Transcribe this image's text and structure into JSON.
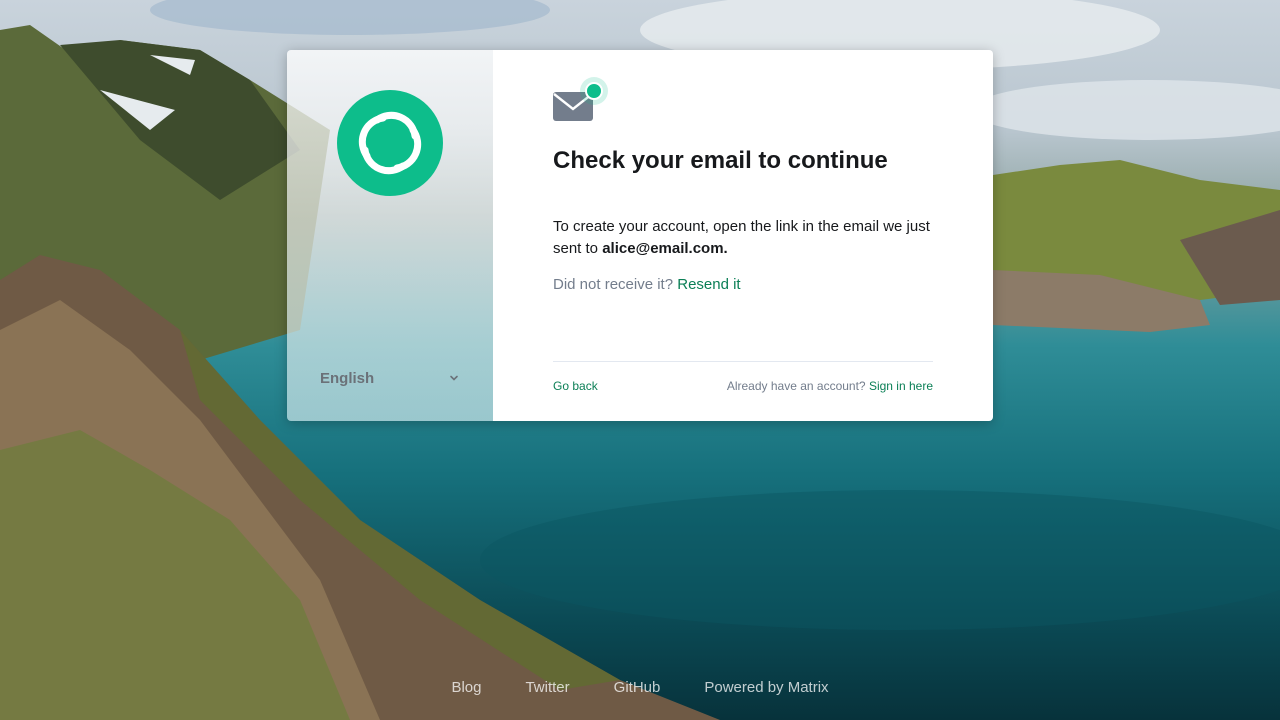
{
  "colors": {
    "brand": "#0dbd8b",
    "link": "#0b7f56",
    "text": "#17191c",
    "muted": "#737d8c"
  },
  "brand_logo": {
    "icon": "element-logo-icon"
  },
  "language": {
    "selected": "English",
    "icon": "chevron-down-icon"
  },
  "card": {
    "icon": "email-notification-icon",
    "title": "Check your email to continue",
    "body_prefix": "To create your account, open the link in the email we just sent to ",
    "email": "alice@email.com.",
    "resend_prompt": "Did not receive it?",
    "resend_link": "Resend it",
    "go_back": "Go back",
    "signin_prompt": "Already have an account?",
    "signin_link": "Sign in here"
  },
  "footer_links": [
    "Blog",
    "Twitter",
    "GitHub",
    "Powered by Matrix"
  ]
}
